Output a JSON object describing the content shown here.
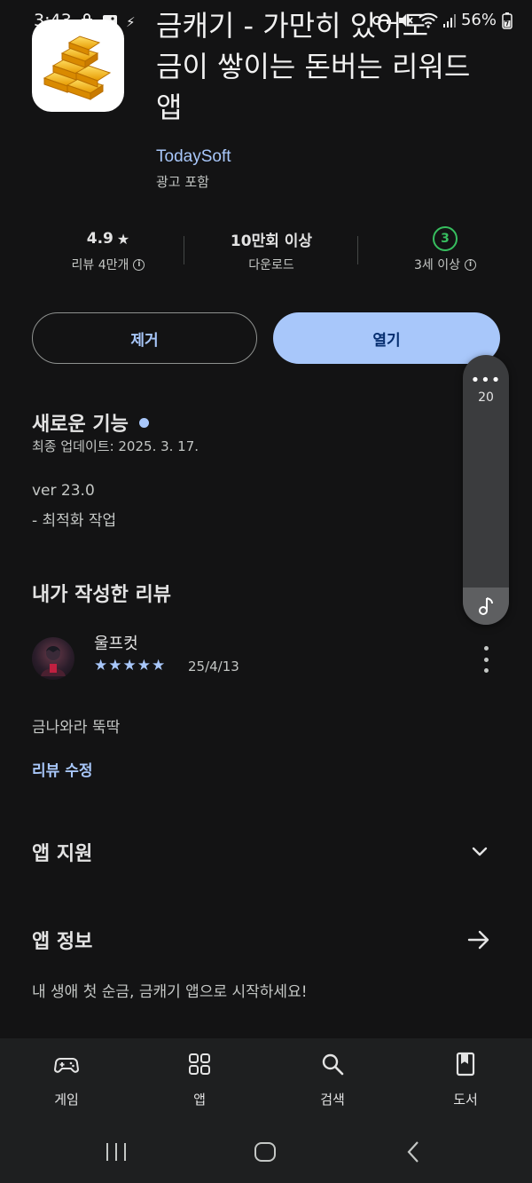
{
  "status_bar": {
    "time": "3:43",
    "battery": "56%"
  },
  "app": {
    "title_line1": "금캐기 - 가만히 있어도",
    "title_line2": "금이 쌓이는 돈버는 리워드",
    "title_line3": "앱",
    "developer": "TodaySoft",
    "ads_note": "광고 포함",
    "icon": "gold-bars-icon"
  },
  "stats": {
    "rating_value": "4.9",
    "rating_label": "리뷰 4만개",
    "downloads_value": "10만회 이상",
    "downloads_label": "다운로드",
    "age_badge": "3",
    "age_label": "3세 이상"
  },
  "buttons": {
    "uninstall": "제거",
    "open": "열기"
  },
  "side_panel": {
    "count": "20"
  },
  "whats_new": {
    "title": "새로운 기능",
    "last_updated": "최종 업데이트: 2025. 3. 17.",
    "version": "ver 23.0",
    "changelog": "- 최적화 작업"
  },
  "my_review": {
    "title": "내가 작성한 리뷰",
    "reviewer_name": "울프컷",
    "stars": 5,
    "date": "25/4/13",
    "text": "금나와라 뚝딱",
    "edit_link": "리뷰 수정"
  },
  "app_support": {
    "title": "앱 지원"
  },
  "app_info": {
    "title": "앱 정보",
    "description": "내 생애 첫 순금, 금캐기 앱으로 시작하세요!"
  },
  "bottom_nav": {
    "items": [
      {
        "label": "게임",
        "icon": "gamepad-icon"
      },
      {
        "label": "앱",
        "icon": "apps-grid-icon"
      },
      {
        "label": "검색",
        "icon": "search-icon"
      },
      {
        "label": "도서",
        "icon": "book-icon"
      }
    ]
  },
  "colors": {
    "background": "#131314",
    "accent": "#a8c7fa",
    "age_badge": "#37be5f"
  }
}
